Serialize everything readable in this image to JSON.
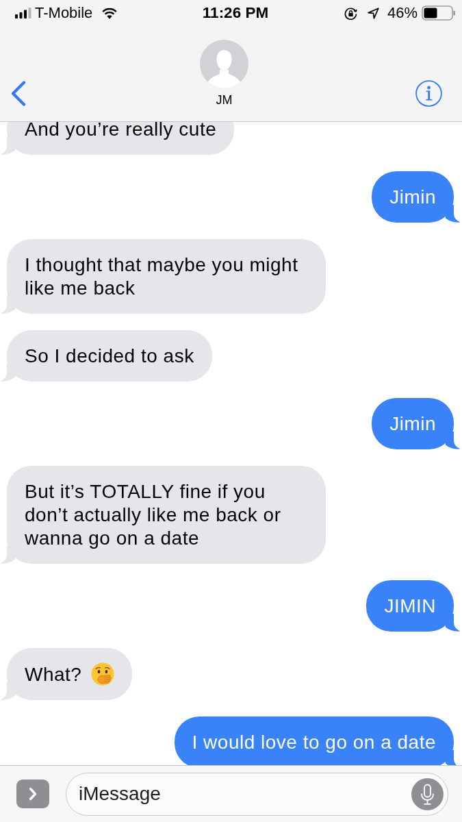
{
  "status_bar": {
    "carrier": "T-Mobile",
    "time": "11:26 PM",
    "battery": "46%"
  },
  "header": {
    "contact_name": "JM"
  },
  "messages": [
    {
      "kind": "received",
      "text": "And you’re really cute",
      "emoji": false
    },
    {
      "kind": "sent",
      "text": "Jimin",
      "emoji": false
    },
    {
      "kind": "received",
      "text": "I thought that maybe you might like me back",
      "emoji": false
    },
    {
      "kind": "received",
      "text": "So I decided to ask",
      "emoji": false
    },
    {
      "kind": "sent",
      "text": "Jimin",
      "emoji": false
    },
    {
      "kind": "received",
      "text": "But it’s TOTALLY fine if you don’t actually like me back or wanna go on a date",
      "emoji": false
    },
    {
      "kind": "sent",
      "text": "JIMIN",
      "emoji": false
    },
    {
      "kind": "received",
      "text": "What?",
      "emoji": true
    },
    {
      "kind": "sent",
      "text": "I would love to go on a date",
      "emoji": false
    }
  ],
  "composer": {
    "placeholder": "iMessage"
  }
}
